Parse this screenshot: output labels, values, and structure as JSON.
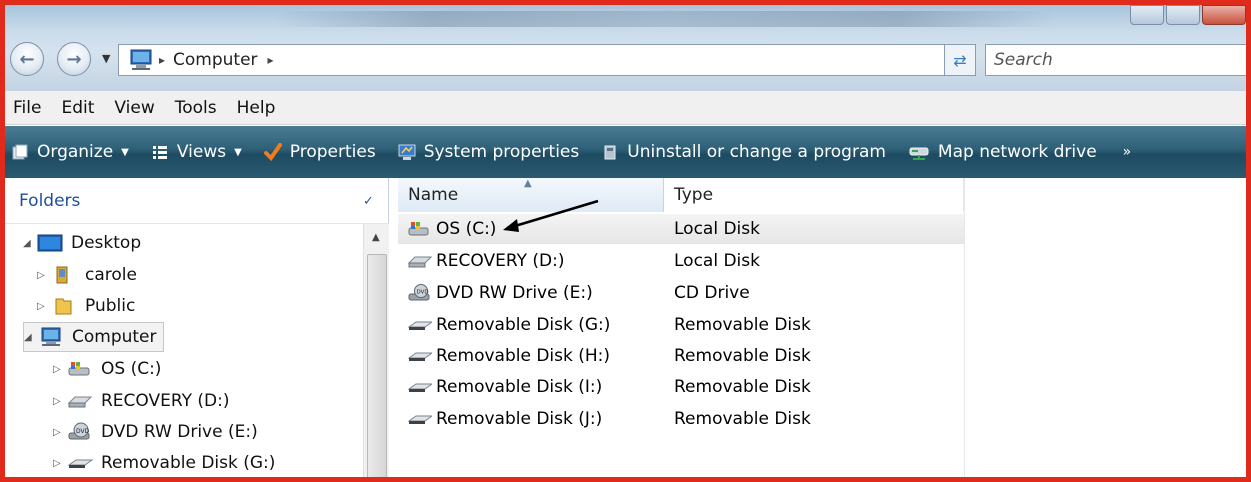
{
  "address": {
    "location": "Computer"
  },
  "search": {
    "placeholder": "Search"
  },
  "menu": [
    "File",
    "Edit",
    "View",
    "Tools",
    "Help"
  ],
  "toolbar": {
    "organize": "Organize",
    "views": "Views",
    "properties": "Properties",
    "system_properties": "System properties",
    "uninstall": "Uninstall or change a program",
    "map_drive": "Map network drive",
    "more": "»"
  },
  "folders": {
    "header": "Folders",
    "tree": [
      {
        "label": "Desktop",
        "icon": "desktop-icon"
      },
      {
        "label": "carole",
        "icon": "user-folder-icon"
      },
      {
        "label": "Public",
        "icon": "folder-icon"
      },
      {
        "label": "Computer",
        "icon": "computer-icon"
      },
      {
        "label": "OS (C:)",
        "icon": "os-drive-icon"
      },
      {
        "label": "RECOVERY (D:)",
        "icon": "hard-drive-icon"
      },
      {
        "label": "DVD RW Drive (E:)",
        "icon": "dvd-drive-icon"
      },
      {
        "label": "Removable Disk (G:)",
        "icon": "removable-disk-icon"
      }
    ]
  },
  "columns": {
    "name": "Name",
    "type": "Type"
  },
  "drives": [
    {
      "name": "OS (C:)",
      "type": "Local Disk",
      "icon": "os-drive-icon"
    },
    {
      "name": "RECOVERY (D:)",
      "type": "Local Disk",
      "icon": "hard-drive-icon"
    },
    {
      "name": "DVD RW Drive (E:)",
      "type": "CD Drive",
      "icon": "dvd-drive-icon"
    },
    {
      "name": "Removable Disk (G:)",
      "type": "Removable Disk",
      "icon": "removable-disk-icon"
    },
    {
      "name": "Removable Disk (H:)",
      "type": "Removable Disk",
      "icon": "removable-disk-icon"
    },
    {
      "name": "Removable Disk (I:)",
      "type": "Removable Disk",
      "icon": "removable-disk-icon"
    },
    {
      "name": "Removable Disk (J:)",
      "type": "Removable Disk",
      "icon": "removable-disk-icon"
    }
  ],
  "colors": {
    "annotation_frame": "#e02a1b",
    "toolbar": "#2d5f76",
    "folders_header": "#1e4f9e"
  }
}
